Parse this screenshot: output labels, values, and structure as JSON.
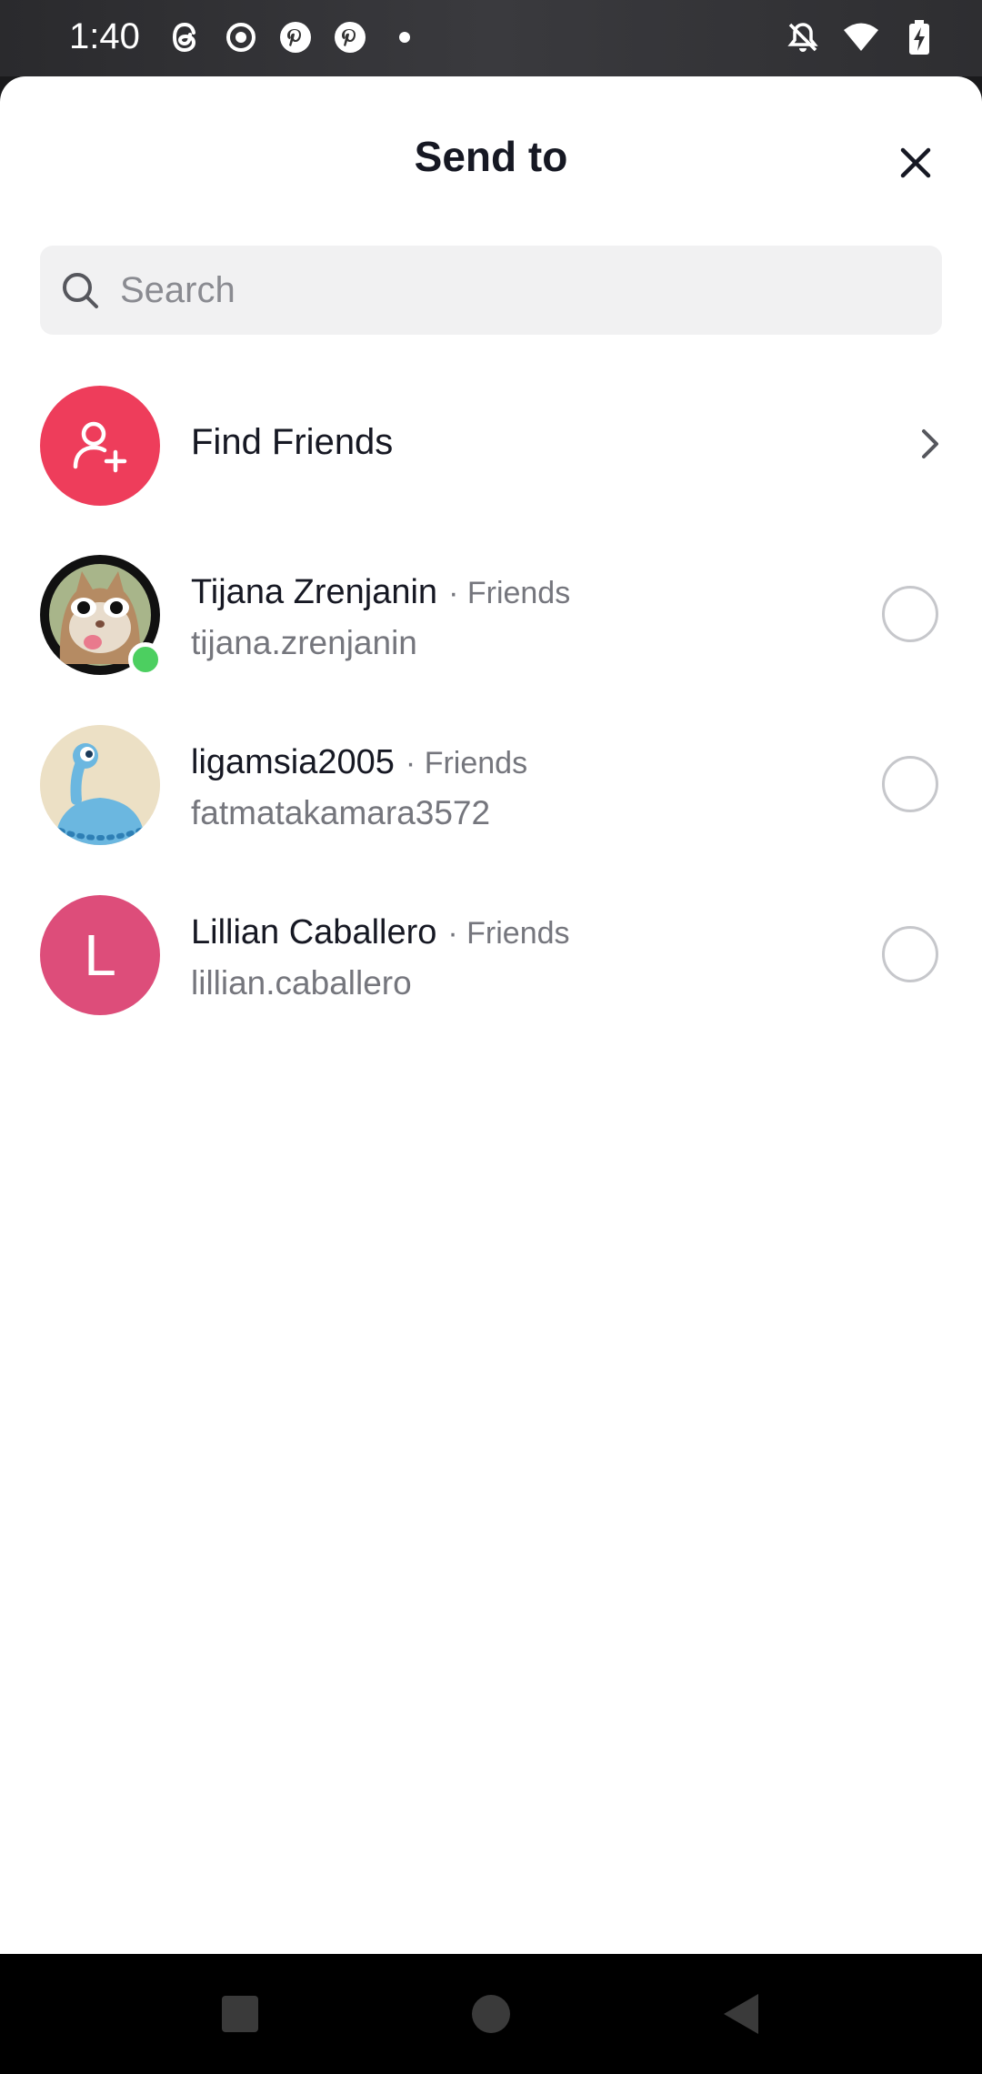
{
  "status_bar": {
    "time": "1:40",
    "left_icons": [
      "threads-icon",
      "record-icon",
      "pinterest-icon",
      "pinterest-icon",
      "dot-icon"
    ],
    "right_icons": [
      "bell-off-icon",
      "wifi-icon",
      "battery-charging-icon"
    ]
  },
  "sheet": {
    "title": "Send to",
    "close_icon": "close-icon"
  },
  "search": {
    "placeholder": "Search",
    "value": ""
  },
  "find_friends": {
    "label": "Find Friends",
    "icon": "add-user-icon",
    "accent": "#ee3d5b"
  },
  "contacts": [
    {
      "name": "Tijana Zrenjanin",
      "relation": "· Friends",
      "username": "tijana.zrenjanin",
      "online": true,
      "selected": false
    },
    {
      "name": "ligamsia2005",
      "relation": "· Friends",
      "username": "fatmatakamara3572",
      "online": false,
      "selected": false
    },
    {
      "name": "Lillian Caballero",
      "relation": "· Friends",
      "username": "lillian.caballero",
      "initial": "L",
      "online": false,
      "selected": false
    }
  ],
  "colors": {
    "online": "#4ccf60",
    "secondary_text": "#75767d"
  },
  "nav_bar": [
    "recents-square-icon",
    "home-circle-icon",
    "back-triangle-icon"
  ]
}
